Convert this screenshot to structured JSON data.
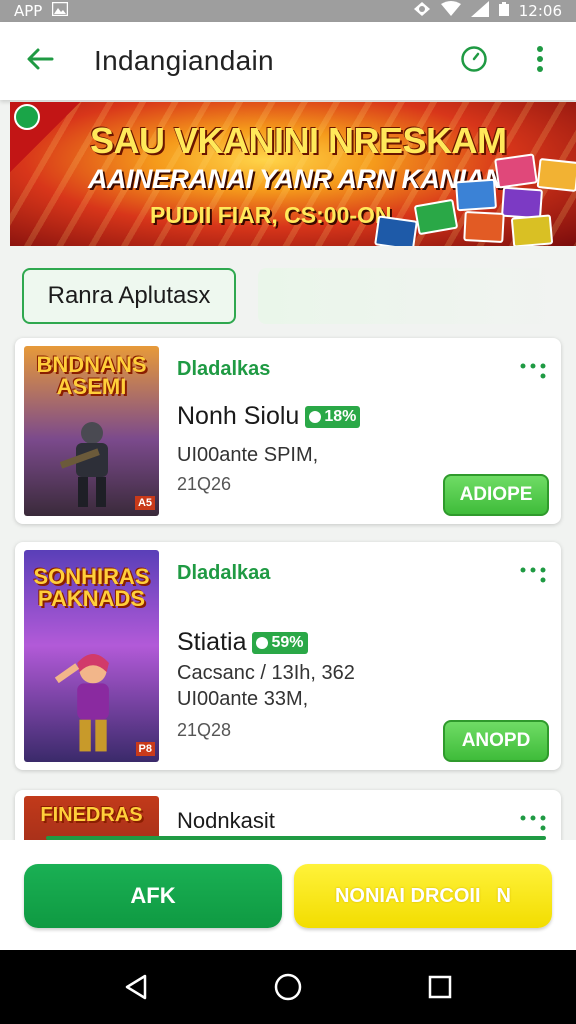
{
  "status_bar": {
    "left_text": "APP",
    "time": "12:06"
  },
  "app_bar": {
    "title": "Indangiandain"
  },
  "banner": {
    "line1": "SAU VKANINI NRESKAM",
    "line2": "AAINERANAI YANR ARN KANIAN",
    "line3": "PUDII FIAR, CS:00-ON"
  },
  "filter_chip": {
    "label": "Ranra Aplutasx"
  },
  "cards": [
    {
      "category": "Dladalkas",
      "name": "Nonh Siolu",
      "rating": "18%",
      "meta": "UI00ante SPIM,",
      "count": "21Q26",
      "button": "ADIOPE",
      "thumb_title": "BNDNANS\nASEMI",
      "thumb_tag": "A5"
    },
    {
      "category": "Dladalkaa",
      "name": "Stiatia",
      "rating": "59%",
      "meta1": "Cacsanc / 13Ih, 362",
      "meta2": "UI00ante 33M,",
      "count": "21Q28",
      "button": "ANOPD",
      "thumb_title": "SONHIRAS\nPAKNADS",
      "thumb_tag": "P8"
    },
    {
      "category": "Nodnkasit",
      "thumb_title": "FINEDRAS"
    }
  ],
  "actions": {
    "primary": "AFK",
    "secondary": "NONIAI DRCOII",
    "secondary_icon": "N"
  },
  "colors": {
    "green": "#1f9a43",
    "yellow": "#f2dd00",
    "banner_red": "#d8361a"
  }
}
